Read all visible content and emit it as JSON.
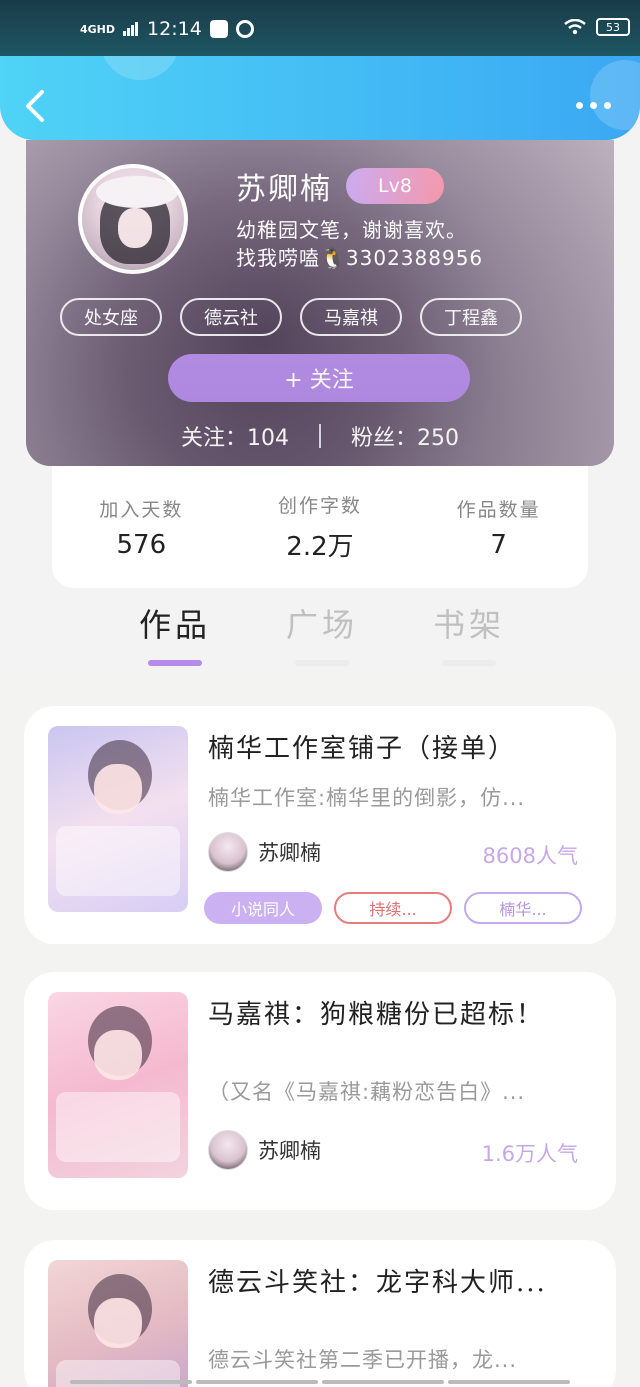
{
  "status_bar": {
    "network": "4GHD",
    "time": "12:14",
    "battery": "53"
  },
  "profile": {
    "name": "苏卿楠",
    "level": "Lv8",
    "bio_line1": "幼稚园文笔，谢谢喜欢。",
    "bio_line2": "找我唠嗑🐧3302388956",
    "tags": [
      "处女座",
      "德云社",
      "马嘉祺",
      "丁程鑫"
    ],
    "follow_button": "+ 关注",
    "following_label": "关注：104",
    "followers_label": "粉丝：250"
  },
  "stats": [
    {
      "label": "加入天数",
      "value": "576"
    },
    {
      "label": "创作字数",
      "value": "2.2万"
    },
    {
      "label": "作品数量",
      "value": "7"
    }
  ],
  "tabs": [
    {
      "label": "作品",
      "active": true
    },
    {
      "label": "广场",
      "active": false
    },
    {
      "label": "书架",
      "active": false
    }
  ],
  "works": [
    {
      "title": "楠华工作室铺子（接单）",
      "description": "楠华工作室:楠华里的倒影，仿...",
      "author": "苏卿楠",
      "popularity": "8608人气",
      "tags": [
        "小说同人",
        "持续...",
        "楠华..."
      ]
    },
    {
      "title": "马嘉祺：狗粮糖份已超标！",
      "description": "（又名《马嘉祺:藕粉恋告白》...",
      "author": "苏卿楠",
      "popularity": "1.6万人气",
      "tags": []
    },
    {
      "title": "德云斗笑社：龙字科大师...",
      "description": "德云斗笑社第二季已开播，龙...",
      "author": "",
      "popularity": "",
      "tags": []
    }
  ],
  "colors": {
    "accent": "#b48be8",
    "header_gradient_start": "#4fd3f6",
    "header_gradient_end": "#3aa8f3",
    "level_badge_start": "#c7a2f0",
    "level_badge_end": "#f58ea4"
  }
}
